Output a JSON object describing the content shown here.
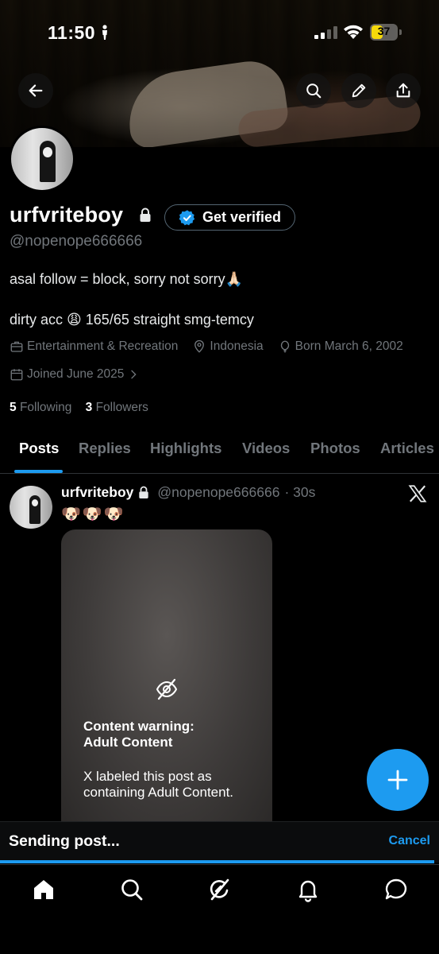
{
  "status_bar": {
    "time": "11:50",
    "battery": "37"
  },
  "header_buttons": [
    "back-icon",
    "search-icon",
    "edit-icon",
    "share-icon"
  ],
  "profile": {
    "name": "urfvriteboy",
    "verify_label": "Get verified",
    "handle": "@nopenope666666",
    "bio_line1": "asal follow = block, sorry not sorry🙏🏻",
    "bio_line2": "dirty acc 😩 165/65 straight smg-temcy",
    "category": "Entertainment & Recreation",
    "location": "Indonesia",
    "born": "Born March 6, 2002",
    "joined": "Joined June 2025",
    "following_count": "5",
    "following_label": "Following",
    "followers_count": "3",
    "followers_label": "Followers"
  },
  "tabs": [
    {
      "label": "Posts",
      "active": true
    },
    {
      "label": "Replies",
      "active": false
    },
    {
      "label": "Highlights",
      "active": false
    },
    {
      "label": "Videos",
      "active": false
    },
    {
      "label": "Photos",
      "active": false
    },
    {
      "label": "Articles",
      "active": false
    }
  ],
  "post": {
    "name": "urfvriteboy",
    "handle": "@nopenope666666",
    "time": "· 30s",
    "text": "🐶🐶🐶",
    "cw_title_line1": "Content warning:",
    "cw_title_line2": "Adult Content",
    "cw_desc_line1": "X labeled this post as",
    "cw_desc_line2": "containing Adult Content."
  },
  "sending": {
    "text": "Sending post...",
    "cancel_label": "Cancel"
  },
  "nav": [
    "home-icon",
    "search-icon",
    "grok-icon",
    "notifications-icon",
    "messages-icon"
  ],
  "colors": {
    "accent": "#1d9bf0",
    "muted": "#71767b",
    "background": "#000000"
  }
}
